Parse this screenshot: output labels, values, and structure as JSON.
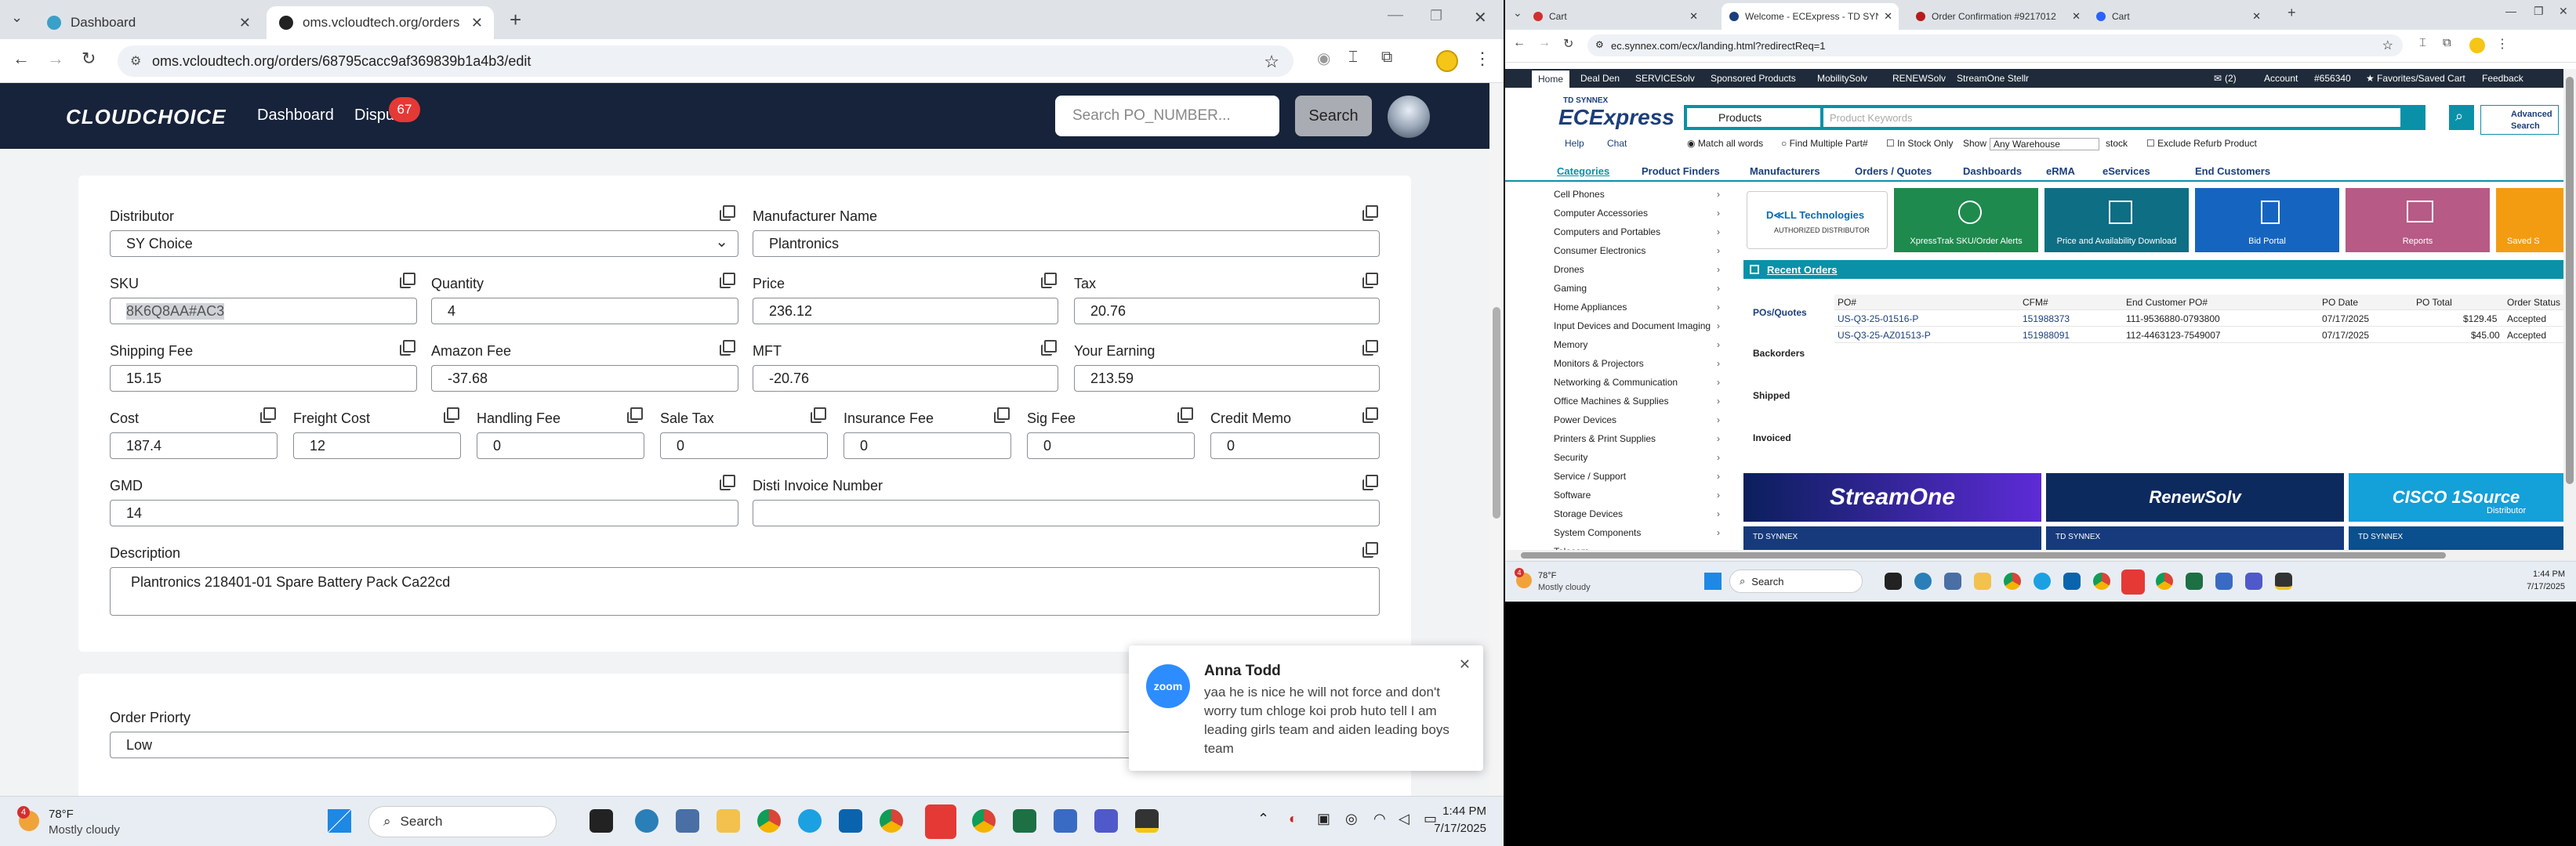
{
  "left": {
    "tabs": [
      {
        "title": "Dashboard",
        "active": false
      },
      {
        "title": "oms.vcloudtech.org/orders/68795cacc9af369839b1a4b3/edit",
        "active": true
      }
    ],
    "url": "oms.vcloudtech.org/orders/68795cacc9af369839b1a4b3/edit",
    "app": {
      "logo": "CLOUDCHOICE",
      "nav_dashboard": "Dashboard",
      "nav_disputes": "Dispu",
      "disputes_count": "67",
      "search_placeholder": "Search PO_NUMBER...",
      "search_button": "Search"
    },
    "form": {
      "distributor_label": "Distributor",
      "distributor_value": "SY Choice",
      "manufacturer_label": "Manufacturer Name",
      "manufacturer_value": "Plantronics",
      "sku_label": "SKU",
      "sku_value": "8K6Q8AA#AC3",
      "quantity_label": "Quantity",
      "quantity_value": "4",
      "price_label": "Price",
      "price_value": "236.12",
      "tax_label": "Tax",
      "tax_value": "20.76",
      "shipping_label": "Shipping Fee",
      "shipping_value": "15.15",
      "amazon_label": "Amazon Fee",
      "amazon_value": "-37.68",
      "mft_label": "MFT",
      "mft_value": "-20.76",
      "earning_label": "Your Earning",
      "earning_value": "213.59",
      "cost_label": "Cost",
      "cost_value": "187.4",
      "freight_label": "Freight Cost",
      "freight_value": "12",
      "handling_label": "Handling Fee",
      "handling_value": "0",
      "saletax_label": "Sale Tax",
      "saletax_value": "0",
      "insurance_label": "Insurance Fee",
      "insurance_value": "0",
      "sig_label": "Sig Fee",
      "sig_value": "0",
      "credit_label": "Credit Memo",
      "credit_value": "0",
      "gmd_label": "GMD",
      "gmd_value": "14",
      "disti_label": "Disti Invoice Number",
      "disti_value": "",
      "desc_label": "Description",
      "desc_value": "Plantronics 218401-01 Spare Battery Pack Ca22cd",
      "priority_label": "Order Priorty",
      "priority_value": "Low"
    },
    "toast": {
      "app": "zoom",
      "sender": "Anna Todd",
      "message": "yaa he is nice he will not force and don't worry tum chloge koi prob huto tell I am leading girls team and aiden leading boys team"
    },
    "taskbar": {
      "weather_temp": "78°F",
      "weather_desc": "Mostly cloudy",
      "weather_badge": "4",
      "search": "Search",
      "time": "1:44 PM",
      "date": "7/17/2025"
    }
  },
  "right": {
    "tabs": [
      {
        "title": "Cart",
        "active": false
      },
      {
        "title": "Welcome - ECExpress - TD SYNNEX",
        "active": true
      },
      {
        "title": "Order Confirmation #9217012",
        "active": false
      },
      {
        "title": "Cart",
        "active": false
      }
    ],
    "url": "ec.synnex.com/ecx/landing.html?redirectReq=1",
    "topnav": [
      "Home",
      "Deal Den",
      "SERVICESolv",
      "Sponsored Products",
      "MobilitySolv",
      "RENEWSolv",
      "StreamOne Stellr"
    ],
    "topright": {
      "messages": "(2)",
      "account": "Account",
      "account_no": "#656340",
      "favorites": "Favorites/Saved Cart",
      "feedback": "Feedback"
    },
    "brand_small": "TD SYNNEX",
    "brand": "ECExpress",
    "products_select": "Products",
    "keyword_placeholder": "Product Keywords",
    "advanced_search": "Advanced Search",
    "help": "Help",
    "chat": "Chat",
    "options": {
      "match_all": "Match all words",
      "find_multiple": "Find Multiple Part#",
      "in_stock": "In Stock Only",
      "show": "Show",
      "warehouse": "Any Warehouse",
      "stock": "stock",
      "exclude": "Exclude Refurb Product"
    },
    "catnav": [
      "Categories",
      "Product Finders",
      "Manufacturers",
      "Orders / Quotes",
      "Dashboards",
      "eRMA",
      "eServices",
      "End Customers"
    ],
    "categories": [
      "Cell Phones",
      "Computer Accessories",
      "Computers and Portables",
      "Consumer Electronics",
      "Drones",
      "Gaming",
      "Home Appliances",
      "Input Devices and Document Imaging",
      "Memory",
      "Monitors & Projectors",
      "Networking & Communication",
      "Office Machines & Supplies",
      "Power Devices",
      "Printers & Print Supplies",
      "Security",
      "Service / Support",
      "Software",
      "Storage Devices",
      "System Components",
      "Telecom"
    ],
    "dell": {
      "line1": "D≪LL Technologies",
      "line2": "AUTHORIZED DISTRIBUTOR"
    },
    "tiles": [
      "XpressTrak SKU/Order Alerts",
      "Price and Availability Download",
      "Bid Portal",
      "Reports",
      "Saved S"
    ],
    "recent_orders": {
      "title": "Recent Orders",
      "side": [
        "POs/Quotes",
        "Backorders",
        "Shipped",
        "Invoiced"
      ],
      "headers": [
        "PO#",
        "CFM#",
        "End Customer PO#",
        "PO Date",
        "PO Total",
        "Order Status"
      ],
      "rows": [
        [
          "US-Q3-25-01516-P",
          "151988373",
          "111-9536880-0793800",
          "07/17/2025",
          "$129.45",
          "Accepted"
        ],
        [
          "US-Q3-25-AZ01513-P",
          "151988091",
          "112-4463123-7549007",
          "07/17/2025",
          "$45.00",
          "Accepted"
        ]
      ]
    },
    "banners": [
      "StreamOne",
      "RenewSolv",
      "CISCO  1Source"
    ],
    "banner_small": [
      "TD SYNNEX",
      "TD SYNNEX",
      "TD SYNNEX"
    ],
    "cisco_sub": "Distributor",
    "taskbar": {
      "weather_temp": "78°F",
      "weather_desc": "Mostly cloudy",
      "weather_badge": "4",
      "search": "Search",
      "time": "1:44 PM",
      "date": "7/17/2025"
    }
  }
}
